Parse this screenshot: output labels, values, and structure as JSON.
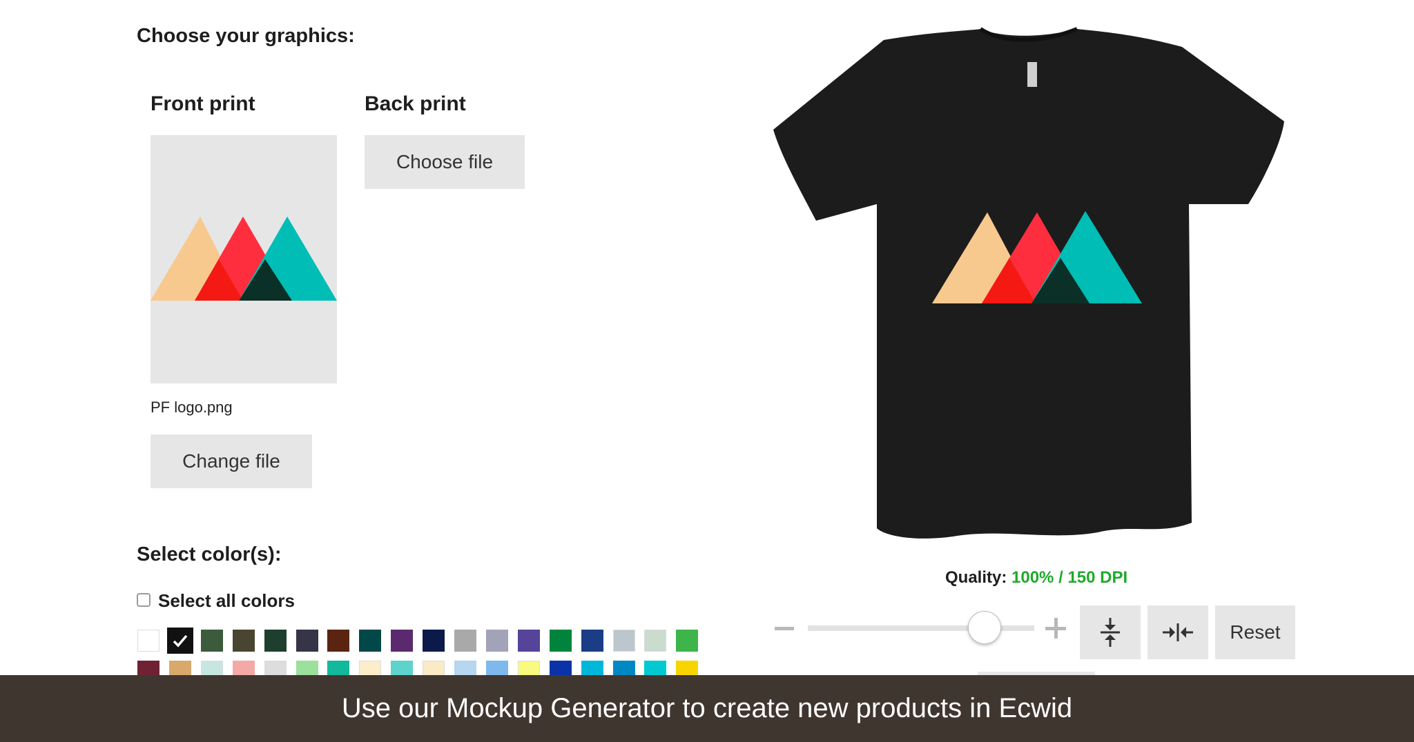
{
  "graphics": {
    "heading": "Choose your graphics:",
    "front": {
      "title": "Front print",
      "file_name": "PF logo.png",
      "change_label": "Change file"
    },
    "back": {
      "title": "Back print",
      "choose_label": "Choose file"
    }
  },
  "colors": {
    "heading": "Select color(s):",
    "select_all_label": "Select all colors",
    "select_all_checked": false,
    "selected_index": 1,
    "row1": [
      "#ffffff",
      "#111111",
      "#3c5a3c",
      "#4a4530",
      "#1f3f2e",
      "#363447",
      "#5a2411",
      "#034848",
      "#5b2a6e",
      "#0c1a4a",
      "#a9a9a9",
      "#a2a3b8",
      "#55449a",
      "#00843d",
      "#1a3d86",
      "#bcc6cd",
      "#c9dccd",
      "#3db54a"
    ],
    "row2": [
      "#6e2233",
      "#d9a86b",
      "#c6e6e1",
      "#f4a9a7",
      "#dddddd",
      "#9be09b",
      "#12b99a",
      "#fbeec9",
      "#5ed3cc",
      "#fbebc4",
      "#b7d6ef",
      "#7eb8ec",
      "#f8fb7e",
      "#0b33a7",
      "#00b7da",
      "#0088c4",
      "#00c9d2",
      "#f9d500"
    ]
  },
  "preview": {
    "shirt_color": "#1c1c1c",
    "logo_colors": {
      "peach": "#f7c98f",
      "red": "#ff2e3e",
      "teal": "#00bdb5",
      "red_overlap": "#f41912",
      "dark_overlap": "#0a3027"
    },
    "quality_label": "Quality:",
    "quality_value": "100% / 150 DPI",
    "scale_percent": 78,
    "reset_label": "Reset",
    "minus_icon": "minus-icon",
    "plus_icon": "plus-icon",
    "align_vertical_icon": "align-vertical-center-icon",
    "align_horizontal_icon": "align-horizontal-center-icon"
  },
  "banner": {
    "text": "Use our Mockup Generator to create new products in Ecwid"
  }
}
